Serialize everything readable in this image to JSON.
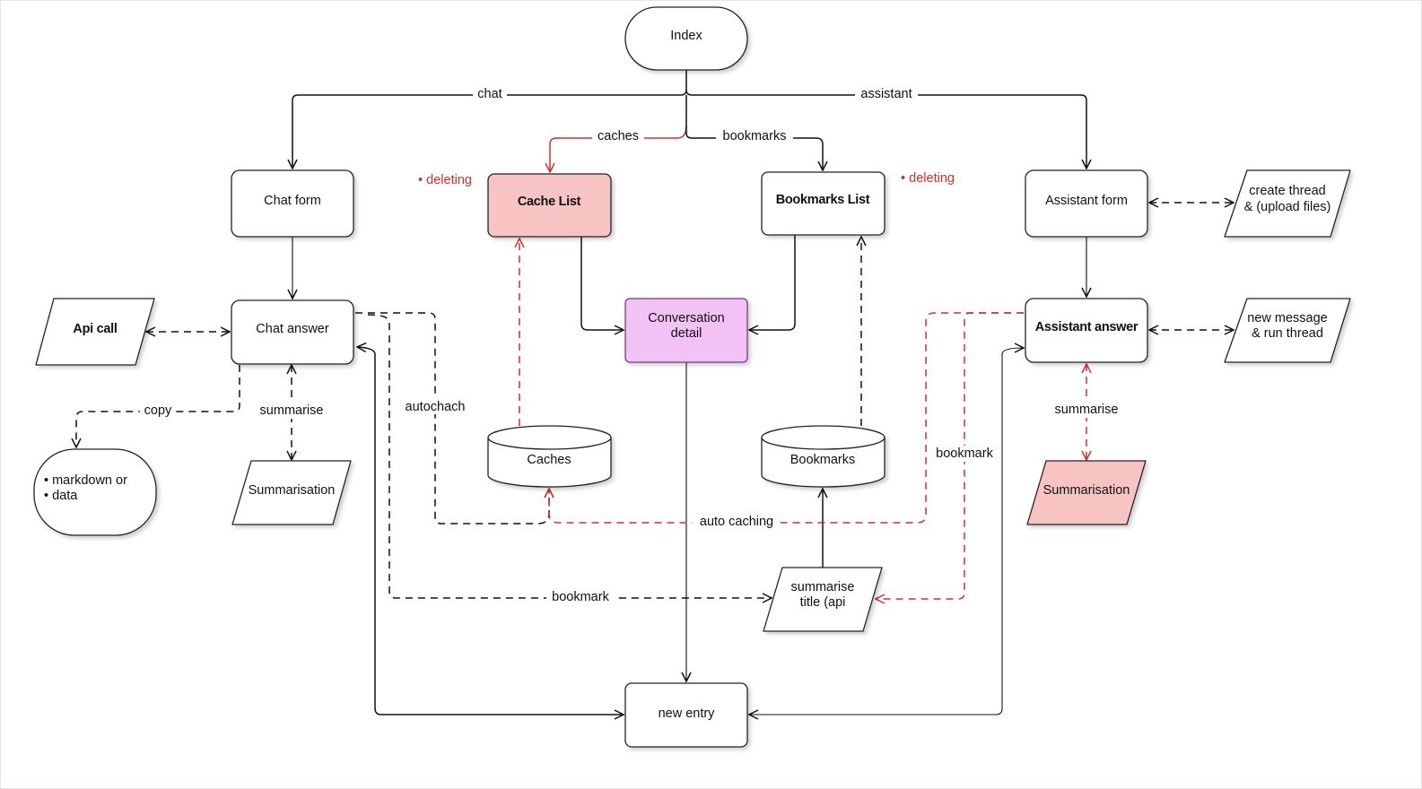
{
  "nodes": {
    "index": "Index",
    "chat_form": "Chat form",
    "cache_list": "Cache List",
    "bookmarks_list": "Bookmarks List",
    "assistant_form": "Assistant form",
    "create_thread": [
      "create thread",
      "& (upload files)"
    ],
    "api_call": "Api call",
    "chat_answer": "Chat answer",
    "conversation_detail": [
      "Conversation",
      "detail"
    ],
    "assistant_answer": "Assistant answer",
    "new_message": [
      "new message",
      "& run thread"
    ],
    "markdown": [
      "• markdown or",
      "• data"
    ],
    "summarisation_left": "Summarisation",
    "caches": "Caches",
    "bookmarks": "Bookmarks",
    "summarisation_right": "Summarisation",
    "summarise_title": [
      "summarise",
      "title (api"
    ],
    "new_entry": "new entry"
  },
  "edge_labels": {
    "chat": "chat",
    "assistant": "assistant",
    "caches": "caches",
    "bookmarks": "bookmarks",
    "copy": "copy",
    "summarise_left": "summarise",
    "autochach": "autochach",
    "auto_caching": "auto caching",
    "bookmark_bottom": "bookmark",
    "bookmark_right": "bookmark",
    "summarise_right": "summarise"
  },
  "notes": {
    "deleting_left": "• deleting",
    "deleting_right": "• deleting"
  },
  "colors": {
    "accent_red": "#c83232",
    "pink_fill": "#f8c3c3",
    "purple_fill": "#f2c2f5"
  }
}
